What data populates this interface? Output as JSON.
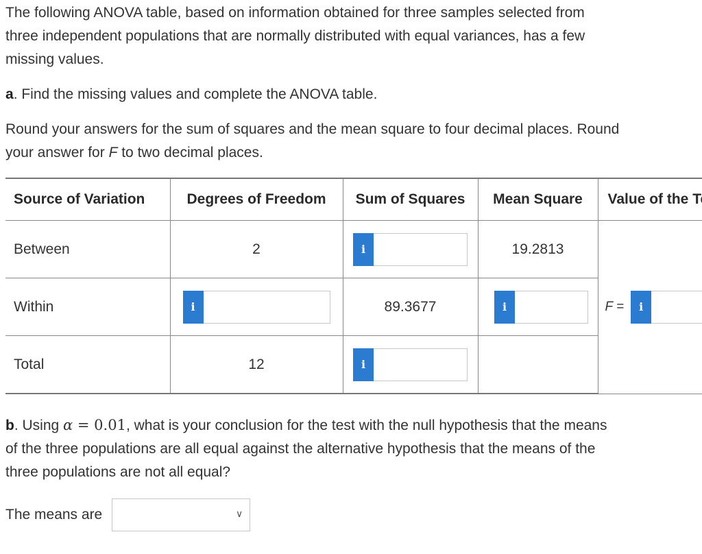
{
  "intro": "The following ANOVA table, based on information obtained for three samples selected from three independent populations that are normally distributed with equal variances, has a few missing values.",
  "intro_lines": [
    "The following ANOVA table, based on information obtained for three samples selected from",
    "three independent populations that are normally distributed with equal variances, has a few",
    "missing values."
  ],
  "part_a": {
    "label": "a",
    "text": ". Find the missing values and complete the ANOVA table."
  },
  "instructions_lines": [
    "Round your answers for the sum of squares and the mean square to four decimal places. Round",
    "your answer for F to two decimal places."
  ],
  "instructions_f": "F",
  "table": {
    "headers": [
      "Source of Variation",
      "Degrees of Freedom",
      "Sum of Squares",
      "Mean Square",
      "Value of the Test Statistic"
    ],
    "rows": [
      {
        "source": "Between",
        "df": "2",
        "ss": "",
        "ms": "19.2813"
      },
      {
        "source": "Within",
        "df": "",
        "ss": "89.3677",
        "ms": ""
      },
      {
        "source": "Total",
        "df": "12",
        "ss": "",
        "ms": ""
      }
    ],
    "f_label": "F =",
    "info_icon_text": "i"
  },
  "part_b": {
    "label": "b",
    "text_1": ". Using ",
    "alpha": "α",
    "equals": " = ",
    "alpha_value": "0.01",
    "text_2": ", what is your conclusion for the test with the null hypothesis that the means",
    "line_2": "of the three populations are all equal against the alternative hypothesis that the means of the",
    "line_3": "three populations are not all equal?"
  },
  "means": {
    "label": "The means are",
    "selected": ""
  },
  "colors": {
    "info_button": "#2b7bd1",
    "text": "#333333",
    "border": "#888888"
  }
}
